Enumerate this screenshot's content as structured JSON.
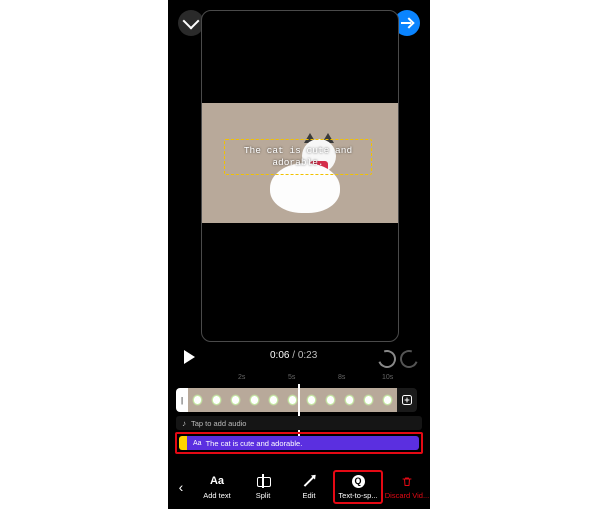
{
  "header": {
    "collapse_icon": "chevron-down",
    "next_icon": "arrow-right"
  },
  "preview": {
    "caption_text": "The cat is cute and\nadorable."
  },
  "transport": {
    "current_time": "0:06",
    "total_time": "0:23"
  },
  "ruler": {
    "marks": [
      "2s",
      "5s",
      "8s",
      "10s"
    ]
  },
  "thumbnails": {
    "handle_glyph": "|"
  },
  "audio_row": {
    "label": "Tap to add audio"
  },
  "caption_clip": {
    "prefix_icon_label": "Aa",
    "text": "The cat is cute and adorable."
  },
  "toolbar": {
    "back_glyph": "‹",
    "items": [
      {
        "icon_label": "Aa",
        "label": "Add text"
      },
      {
        "icon_label": "",
        "label": "Split"
      },
      {
        "icon_label": "",
        "label": "Edit"
      },
      {
        "icon_label": "Q",
        "label": "Text-to-sp..."
      },
      {
        "icon_label": "",
        "label": "Discard Vid..."
      }
    ]
  }
}
